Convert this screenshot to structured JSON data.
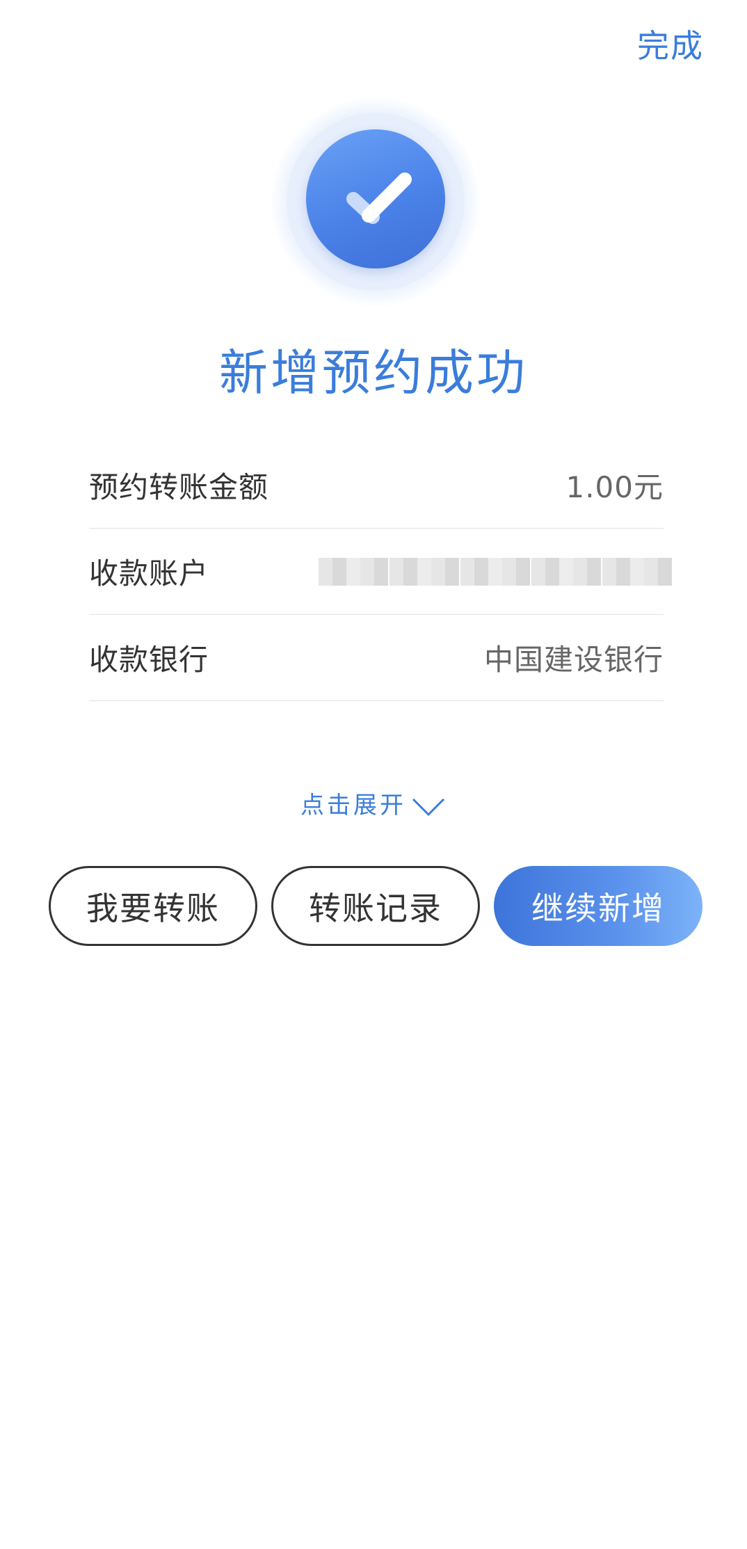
{
  "header": {
    "done_label": "完成"
  },
  "status": {
    "icon": "check-circle-icon",
    "title": "新增预约成功"
  },
  "details": [
    {
      "label": "预约转账金额",
      "value": "1.00元"
    },
    {
      "label": "收款账户",
      "value": ""
    },
    {
      "label": "收款银行",
      "value": "中国建设银行"
    }
  ],
  "expand": {
    "label": "点击展开",
    "icon": "chevron-down-icon"
  },
  "actions": {
    "transfer": "我要转账",
    "records": "转账记录",
    "continue": "继续新增"
  },
  "colors": {
    "accent": "#3a7ddb",
    "primary_gradient_start": "#3d74da",
    "primary_gradient_end": "#7cb3f8"
  }
}
